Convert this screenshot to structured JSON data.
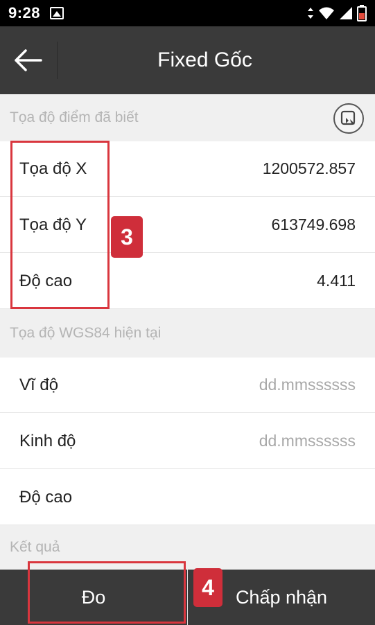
{
  "status_bar": {
    "time": "9:28"
  },
  "app_bar": {
    "title": "Fixed Gốc"
  },
  "known_point": {
    "header": "Tọa độ điểm đã biết",
    "rows": [
      {
        "label": "Tọa độ X",
        "value": "1200572.857"
      },
      {
        "label": "Tọa độ Y",
        "value": "613749.698"
      },
      {
        "label": "Độ cao",
        "value": "4.411"
      }
    ]
  },
  "current_wgs84": {
    "header": "Tọa độ WGS84 hiện tại",
    "rows": [
      {
        "label": "Vĩ độ",
        "placeholder": "dd.mmssssss"
      },
      {
        "label": "Kinh độ",
        "placeholder": "dd.mmssssss"
      },
      {
        "label": "Độ cao",
        "placeholder": ""
      }
    ]
  },
  "result": {
    "header": "Kết quả"
  },
  "bottom_bar": {
    "measure_label": "Đo",
    "accept_label": "Chấp nhận"
  },
  "annotations": {
    "badge_3": "3",
    "badge_4": "4"
  },
  "colors": {
    "app_bar": "#3a3a3a",
    "annotation": "#cf2e3a",
    "section_bg": "#f0f0f0"
  }
}
